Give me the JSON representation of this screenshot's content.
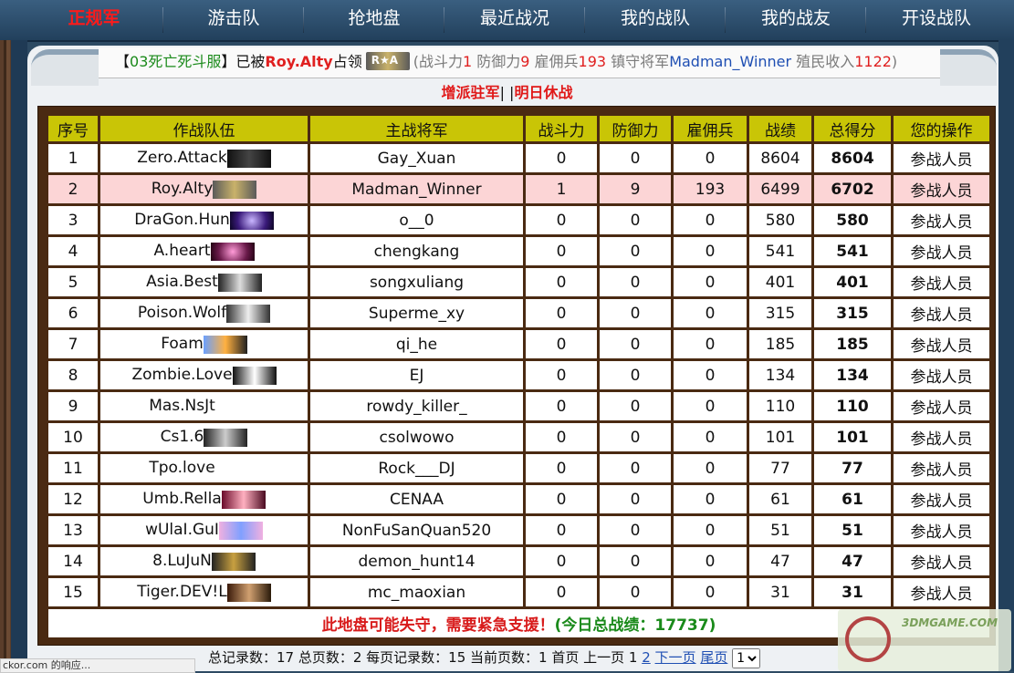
{
  "nav": {
    "tabs": [
      {
        "label": "正规军"
      },
      {
        "label": "游击队"
      },
      {
        "label": "抢地盘"
      },
      {
        "label": "最近战况"
      },
      {
        "label": "我的战队"
      },
      {
        "label": "我的战友"
      },
      {
        "label": "开设战队"
      }
    ]
  },
  "info": {
    "bracket_open": "【",
    "server": "03死亡死斗服",
    "bracket_close": "】",
    "occupied_by": "已被",
    "team": "Roy.Alty",
    "occupy": "占领",
    "paren_open": "(战斗力",
    "power": "1",
    "defense_label": " 防御力",
    "defense": "9",
    "merc_label": " 雇佣兵",
    "merc": "193",
    "general_label": " 镇守将军",
    "general": "Madman_Winner",
    "income_label": " 殖民收入",
    "income": "1122",
    "paren_close": ")"
  },
  "actions": {
    "reinforce": "增派驻军",
    "pipe": "| |",
    "rest": "明日休战"
  },
  "table": {
    "headers": [
      "序号",
      "作战队伍",
      "主战将军",
      "战斗力",
      "防御力",
      "雇佣兵",
      "战绩",
      "总得分",
      "您的操作"
    ],
    "rows": [
      {
        "no": "1",
        "team": "Zero.Attack",
        "general": "Gay_Xuan",
        "power": "0",
        "defense": "0",
        "merc": "0",
        "record": "8604",
        "total": "8604",
        "op": "参战人员"
      },
      {
        "no": "2",
        "team": "Roy.Alty",
        "general": "Madman_Winner",
        "power": "1",
        "defense": "9",
        "merc": "193",
        "record": "6499",
        "total": "6702",
        "op": "参战人员"
      },
      {
        "no": "3",
        "team": "DraGon.Hun",
        "general": "o__0",
        "power": "0",
        "defense": "0",
        "merc": "0",
        "record": "580",
        "total": "580",
        "op": "参战人员"
      },
      {
        "no": "4",
        "team": "A.heart",
        "general": "chengkang",
        "power": "0",
        "defense": "0",
        "merc": "0",
        "record": "541",
        "total": "541",
        "op": "参战人员"
      },
      {
        "no": "5",
        "team": "Asia.Best",
        "general": "songxuliang",
        "power": "0",
        "defense": "0",
        "merc": "0",
        "record": "401",
        "total": "401",
        "op": "参战人员"
      },
      {
        "no": "6",
        "team": "Poison.Wolf",
        "general": "Superme_xy",
        "power": "0",
        "defense": "0",
        "merc": "0",
        "record": "315",
        "total": "315",
        "op": "参战人员"
      },
      {
        "no": "7",
        "team": "Foam",
        "general": "qi_he",
        "power": "0",
        "defense": "0",
        "merc": "0",
        "record": "185",
        "total": "185",
        "op": "参战人员"
      },
      {
        "no": "8",
        "team": "Zombie.Love",
        "general": "EJ",
        "power": "0",
        "defense": "0",
        "merc": "0",
        "record": "134",
        "total": "134",
        "op": "参战人员"
      },
      {
        "no": "9",
        "team": "Mas.NsJt",
        "general": "rowdy_killer_",
        "power": "0",
        "defense": "0",
        "merc": "0",
        "record": "110",
        "total": "110",
        "op": "参战人员"
      },
      {
        "no": "10",
        "team": "Cs1.6",
        "general": "csolwowo",
        "power": "0",
        "defense": "0",
        "merc": "0",
        "record": "101",
        "total": "101",
        "op": "参战人员"
      },
      {
        "no": "11",
        "team": "Tpo.love",
        "general": "Rock___DJ",
        "power": "0",
        "defense": "0",
        "merc": "0",
        "record": "77",
        "total": "77",
        "op": "参战人员"
      },
      {
        "no": "12",
        "team": "Umb.Rella",
        "general": "CENAA",
        "power": "0",
        "defense": "0",
        "merc": "0",
        "record": "61",
        "total": "61",
        "op": "参战人员"
      },
      {
        "no": "13",
        "team": "wUlaI.GuI",
        "general": "NonFuSanQuan520",
        "power": "0",
        "defense": "0",
        "merc": "0",
        "record": "51",
        "total": "51",
        "op": "参战人员"
      },
      {
        "no": "14",
        "team": "8.LuJuN",
        "general": "demon_hunt14",
        "power": "0",
        "defense": "0",
        "merc": "0",
        "record": "47",
        "total": "47",
        "op": "参战人员"
      },
      {
        "no": "15",
        "team": "Tiger.DEV!L",
        "general": "mc_maoxian",
        "power": "0",
        "defense": "0",
        "merc": "0",
        "record": "31",
        "total": "31",
        "op": "参战人员"
      }
    ],
    "footer_warning": "此地盘可能失守，需要紧急支援！",
    "footer_today": "(今日总战绩：17737)"
  },
  "pager": {
    "summary": "总记录数：17 总页数：2 每页记录数：15 当前页数：1 首页 上一页 1",
    "page2": "2",
    "next": "下一页",
    "last": "尾页",
    "select_value": "1"
  },
  "statusbar": {
    "text": "ckor.com 的响应..."
  },
  "watermark": {
    "text": "3DMGAME.COM"
  }
}
